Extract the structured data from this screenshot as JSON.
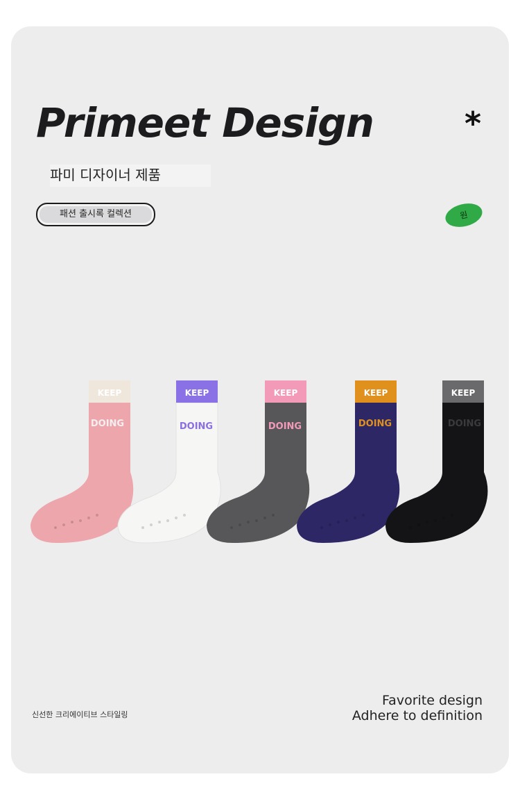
{
  "header": {
    "title": "Primeet Design",
    "asterisk": "*",
    "subtitle": "파미 디자이너 제품",
    "pill_label": "패션 출시록 컬렉션",
    "badge_label": "원"
  },
  "socks": [
    {
      "top_text": "KEEP",
      "body_text": "DOING",
      "cuff": "#efe7dc",
      "body": "#eca6ac",
      "cuff_text": "#ffffff",
      "body_text_color": "#f4eef0"
    },
    {
      "top_text": "KEEP",
      "body_text": "DOING",
      "cuff": "#8a72e6",
      "body": "#f6f6f4",
      "cuff_text": "#ffffff",
      "body_text_color": "#8b6fe0"
    },
    {
      "top_text": "KEEP",
      "body_text": "DOING",
      "cuff": "#f29ab8",
      "body": "#575759",
      "cuff_text": "#ffffff",
      "body_text_color": "#f29ab8"
    },
    {
      "top_text": "KEEP",
      "body_text": "DOING",
      "cuff": "#e0901d",
      "body": "#2e2766",
      "cuff_text": "#ffffff",
      "body_text_color": "#e0901d"
    },
    {
      "top_text": "KEEP",
      "body_text": "DOING",
      "cuff": "#6a6a6c",
      "body": "#141416",
      "cuff_text": "#ffffff",
      "body_text_color": "#3a3a3c"
    }
  ],
  "footer": {
    "left_text": "신선한 크리에이티브 스타일링",
    "right_line1": "Favorite design",
    "right_line2": "Adhere to definition"
  }
}
